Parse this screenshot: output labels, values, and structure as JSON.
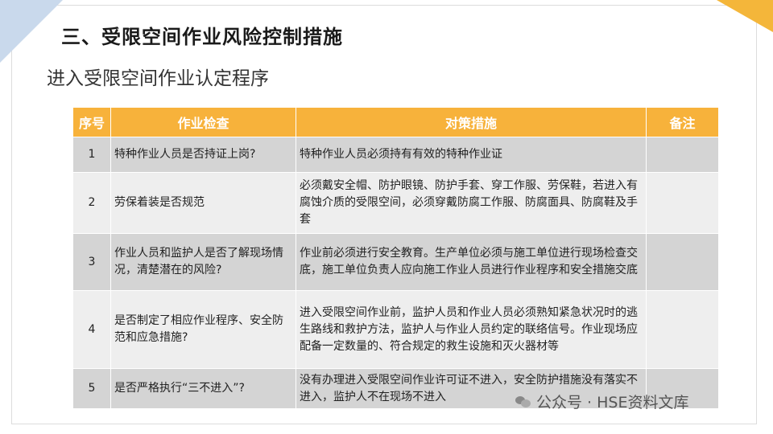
{
  "slide": {
    "title": "三、受限空间作业风险控制措施",
    "subtitle": "进入受限空间作业认定程序"
  },
  "table": {
    "headers": [
      "序号",
      "作业检查",
      "对策措施",
      "备注"
    ],
    "rows": [
      {
        "no": "1",
        "check": "特种作业人员是否持证上岗?",
        "measure": "特种作业人员必须持有有效的特种作业证",
        "note": ""
      },
      {
        "no": "2",
        "check": "劳保着装是否规范",
        "measure": "必须戴安全帽、防护眼镜、防护手套、穿工作服、劳保鞋，若进入有腐蚀介质的受限空间，必须穿戴防腐工作服、防腐面具、防腐鞋及手套",
        "note": ""
      },
      {
        "no": "3",
        "check": "作业人员和监护人是否了解现场情况，清楚潜在的风险?",
        "measure": "作业前必须进行安全教育。生产单位必须与施工单位进行现场检查交底，施工单位负责人应向施工作业人员进行作业程序和安全措施交底",
        "note": ""
      },
      {
        "no": "4",
        "check": "是否制定了相应作业程序、安全防范和应急措施?",
        "measure": "进入受限空间作业前，监护人员和作业人员必须熟知紧急状况时的逃生路线和救护方法，监护人与作业人员约定的联络信号。作业现场应配备一定数量的、符合规定的救生设施和灭火器材等",
        "note": ""
      },
      {
        "no": "5",
        "check": "是否严格执行“三不进入”?",
        "measure": "没有办理进入受限空间作业许可证不进入，安全防护措施没有落实不进入，监护人不在现场不进入",
        "note": ""
      }
    ]
  },
  "watermark": {
    "text": "公众号 · HSE资料文库",
    "icon": "wechat-icon"
  },
  "colors": {
    "header_bg": "#f7b23b",
    "row_dark": "#d4d4d4",
    "row_light": "#eeeeee",
    "corner_blue": "#c9d9ec",
    "corner_orange": "#f4b63a"
  }
}
